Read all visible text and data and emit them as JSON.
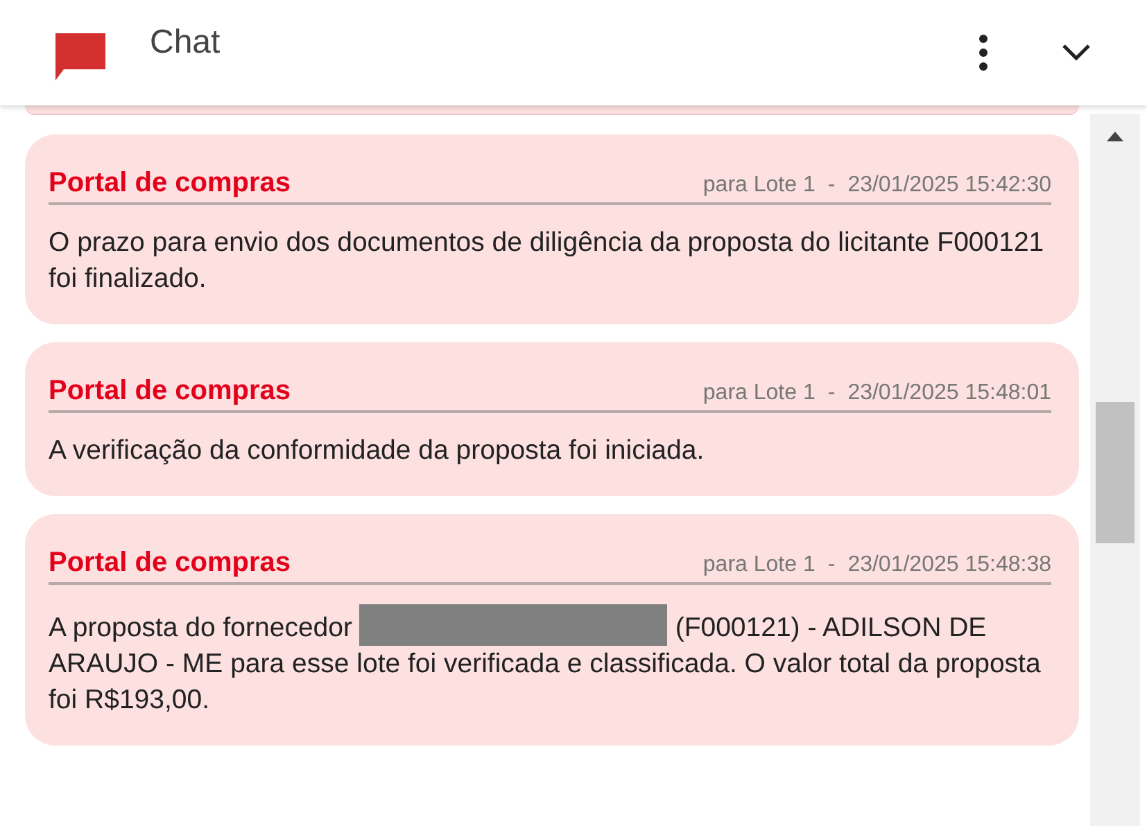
{
  "header": {
    "title": "Chat"
  },
  "messages": [
    {
      "sender": "Portal de compras",
      "target": "para Lote 1",
      "separator": "-",
      "time": "23/01/2025 15:42:30",
      "body": [
        {
          "kind": "text",
          "text": "O prazo para envio dos documentos de diligência da proposta do licitante F000121 foi finalizado."
        }
      ]
    },
    {
      "sender": "Portal de compras",
      "target": "para Lote 1",
      "separator": "-",
      "time": "23/01/2025 15:48:01",
      "body": [
        {
          "kind": "text",
          "text": "A verificação da conformidade da proposta foi iniciada."
        }
      ]
    },
    {
      "sender": "Portal de compras",
      "target": "para Lote 1",
      "separator": "-",
      "time": "23/01/2025 15:48:38",
      "body": [
        {
          "kind": "text",
          "text": "A proposta do fornecedor "
        },
        {
          "kind": "redacted"
        },
        {
          "kind": "text",
          "text": " (F000121) - ADILSON DE ARAUJO - ME para esse lote foi verificada e classificada. O valor total da proposta foi R$193,00."
        }
      ]
    }
  ]
}
